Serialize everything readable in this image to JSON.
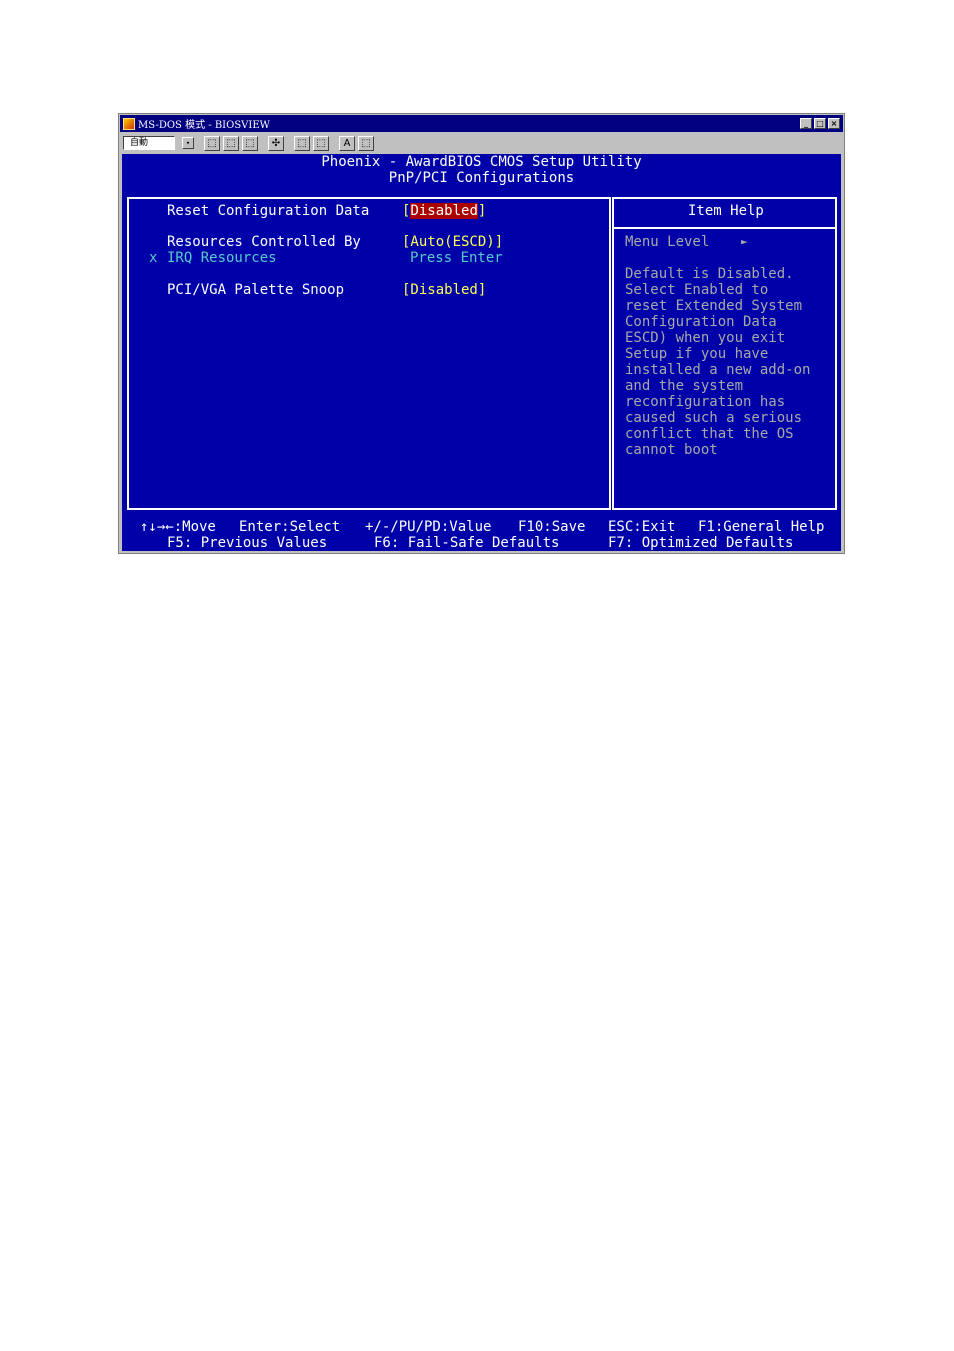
{
  "window": {
    "title": "MS-DOS 模式 - BIOSVIEW",
    "controls": [
      "_",
      "□",
      "×"
    ]
  },
  "toolbar": {
    "font_value": "自動",
    "dropdown_glyph": "▾",
    "buttons": [
      "⬚",
      "⬚",
      "⬚",
      "✣",
      "⬚",
      "⬚",
      "A",
      "⬚"
    ]
  },
  "bios": {
    "header_line1": "Phoenix - AwardBIOS CMOS Setup Utility",
    "header_line2": "PnP/PCI Configurations",
    "items": [
      {
        "label": "Reset Configuration Data",
        "value_prefix": "[",
        "value": "Disabled",
        "value_suffix": "]"
      },
      {
        "label": "Resources Controlled By",
        "value": "[Auto(ESCD)]"
      },
      {
        "marker": "x",
        "label": "IRQ Resources",
        "value": "Press Enter"
      },
      {
        "label": "PCI/VGA Palette Snoop",
        "value": "[Disabled]"
      }
    ],
    "help": {
      "title": "Item Help",
      "menu_level_label": "Menu Level",
      "menu_level_arrow": "►",
      "lines": [
        "Default is Disabled.",
        "Select Enabled to",
        "reset Extended System",
        "Configuration Data",
        "ESCD) when you exit",
        "Setup if you have",
        "installed a new add-on",
        "and the system",
        "reconfiguration has",
        "caused such a serious",
        "conflict that the OS",
        "cannot boot"
      ]
    },
    "footer": {
      "row1": [
        "↑↓→←:Move",
        "Enter:Select",
        "+/-/PU/PD:Value",
        "F10:Save",
        "ESC:Exit",
        "F1:General Help"
      ],
      "row2": [
        "F5: Previous Values",
        "F6: Fail-Safe Defaults",
        "F7: Optimized Defaults"
      ]
    }
  }
}
